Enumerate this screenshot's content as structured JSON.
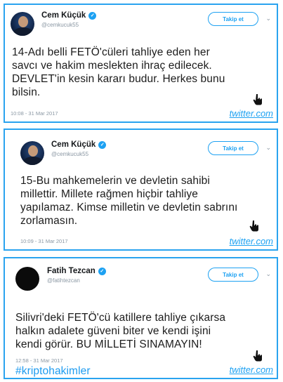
{
  "tweets": [
    {
      "name": "Cem Küçük",
      "handle": "@cemkucuk55",
      "follow_label": "Takip et",
      "text": "14-Adı belli FETÖ'cüleri tahliye eden her\nsavcı ve hakim meslekten ihraç edilecek.\nDEVLET'in kesin kararı budur. Herkes bunu\nbilsin.",
      "hashtag": "",
      "time": "10:08 - 31 Mar 2017",
      "brand": "twitter.com"
    },
    {
      "name": "Cem Küçük",
      "handle": "@cemkucuk55",
      "follow_label": "Takip et",
      "text": "15-Bu mahkemelerin ve devletin sahibi\nmillettir. Millete rağmen hiçbir tahliye\nyapılamaz. Kimse milletin ve devletin sabrını\nzorlamasın.",
      "hashtag": "",
      "time": "10:09 - 31 Mar 2017",
      "brand": "twitter.com"
    },
    {
      "name": "Fatih Tezcan",
      "handle": "@fatihtezcan",
      "follow_label": "Takip et",
      "text": "Silivri'deki FETÖ'cü katillere tahliye çıkarsa\nhalkın adalete güveni biter ve kendi işini\nkendi görür. BU MİLLETİ SINAMAYIN!",
      "hashtag": "#kriptohakimler",
      "time": "12:58 - 31 Mar 2017",
      "brand": "twitter.com"
    }
  ],
  "icons": {
    "verified": "verified-badge-icon",
    "chevron": "chevron-down-icon",
    "cursor": "hand-pointer-icon"
  },
  "colors": {
    "border": "#2aa3ef",
    "accent": "#1da1f2"
  }
}
